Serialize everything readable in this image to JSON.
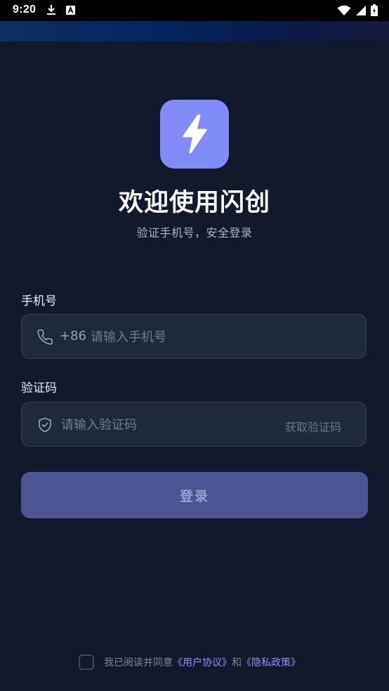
{
  "status_bar": {
    "time": "9:20"
  },
  "header": {
    "title": "欢迎使用闪创",
    "subtitle": "验证手机号，安全登录"
  },
  "phone_field": {
    "label": "手机号",
    "prefix": "+86",
    "placeholder": "请输入手机号",
    "value": ""
  },
  "code_field": {
    "label": "验证码",
    "placeholder": "请输入验证码",
    "value": "",
    "get_code_label": "获取验证码"
  },
  "login_button": {
    "label": "登录"
  },
  "agreement": {
    "prefix": "我已阅读并同意",
    "user_agreement": "《用户协议》",
    "conjunction": "和",
    "privacy_policy": "《隐私政策》",
    "checked": false
  },
  "icons": {
    "logo": "lightning-icon",
    "phone": "phone-icon",
    "code": "shield-check-icon"
  },
  "colors": {
    "background": "#111a2c",
    "accent": "#818cf8",
    "button": "#4c5592",
    "link": "#8b93f5"
  }
}
